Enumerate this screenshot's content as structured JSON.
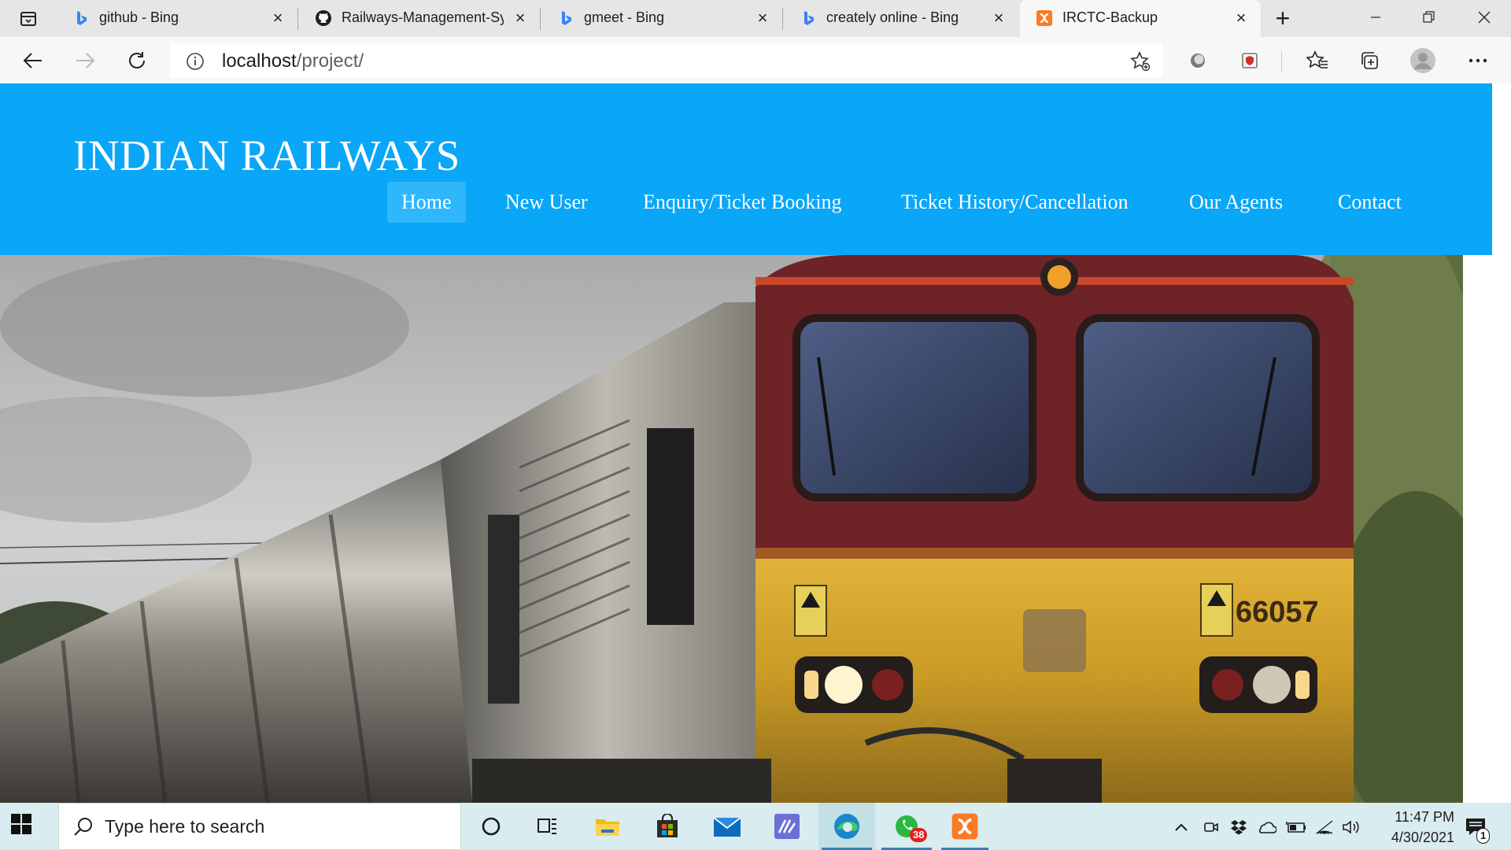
{
  "browser": {
    "tabs": [
      {
        "title": "github - Bing",
        "icon": "bing-icon",
        "active": false
      },
      {
        "title": "Railways-Management-Sy",
        "icon": "github-icon",
        "active": false
      },
      {
        "title": "gmeet - Bing",
        "icon": "bing-icon",
        "active": false
      },
      {
        "title": "creately online - Bing",
        "icon": "bing-icon",
        "active": false
      },
      {
        "title": "IRCTC-Backup",
        "icon": "xampp-icon",
        "active": true
      }
    ],
    "address": {
      "host": "localhost",
      "path": "/project/"
    }
  },
  "site": {
    "title": "INDIAN RAILWAYS",
    "nav": [
      {
        "label": "Home",
        "active": true
      },
      {
        "label": "New User",
        "active": false
      },
      {
        "label": "Enquiry/Ticket Booking",
        "active": false
      },
      {
        "label": "Ticket History/Cancellation",
        "active": false
      },
      {
        "label": "Our Agents",
        "active": false
      },
      {
        "label": "Contact",
        "active": false
      }
    ],
    "hero": {
      "loco_number": "66057"
    },
    "colors": {
      "header": "#0aa6f7",
      "nav_active": "#2fb7fb"
    }
  },
  "taskbar": {
    "search_placeholder": "Type here to search",
    "time": "11:47 PM",
    "date": "4/30/2021",
    "whatsapp_badge": "38",
    "notifications_badge": "1"
  }
}
